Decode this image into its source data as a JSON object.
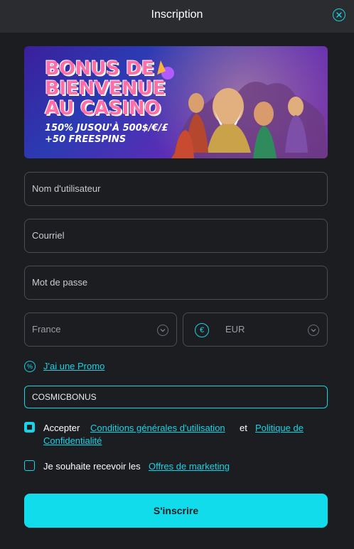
{
  "modal": {
    "title": "Inscription"
  },
  "banner": {
    "headline": "BONUS DE\nBIENVENUE\nAU CASINO",
    "subline": "150% JUSQU'À 500$/€/£\n+50 FREESPINS"
  },
  "form": {
    "username_placeholder": "Nom d'utilisateur",
    "email_placeholder": "Courriel",
    "password_placeholder": "Mot de passe",
    "country_value": "France",
    "currency_value": "EUR",
    "currency_symbol": "€",
    "promo_toggle_label": "J'ai une Promo",
    "promo_code_value": "COSMICBONUS",
    "terms": {
      "prefix": "Accepter",
      "link1": "Conditions générales d'utilisation",
      "conjunction": "et",
      "link2_part1": "Politique de",
      "link2_part2": "Confidentialité",
      "checked": true
    },
    "marketing": {
      "prefix": "Je souhaite recevoir les",
      "link": "Offres de marketing",
      "checked": false
    },
    "submit_label": "S'inscrire"
  },
  "colors": {
    "accent": "#18d3e6",
    "background": "#1c1d20",
    "header": "#2a2c30",
    "button": "#10dcec"
  },
  "icons": [
    "close-icon",
    "euro-icon",
    "chevron-down-icon",
    "promo-icon",
    "checkbox-icon"
  ]
}
